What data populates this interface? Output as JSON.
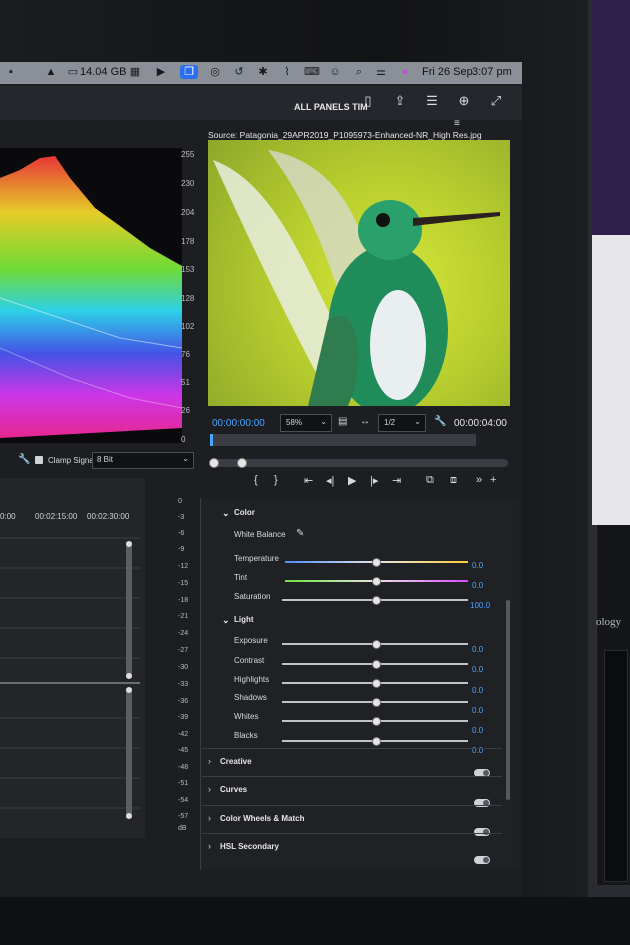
{
  "menubar": {
    "storage": "14.04 GB",
    "date": "Fri 26 Sep",
    "time": "3:07 pm"
  },
  "toolbar": {
    "workspace_label": "ALL PANELS TIM"
  },
  "scope": {
    "scale": [
      "255",
      "230",
      "204",
      "178",
      "153",
      "128",
      "102",
      "76",
      "51",
      "26",
      "0"
    ],
    "clamp_label": "Clamp Signal",
    "bit_depth": "8 Bit"
  },
  "timeline": {
    "ruler": [
      "0:00",
      "00:02:15:00",
      "00:02:30:00"
    ]
  },
  "meter": {
    "scale": [
      "0",
      "-3",
      "-6",
      "-9",
      "-12",
      "-15",
      "-18",
      "-21",
      "-24",
      "-27",
      "-30",
      "-33",
      "-36",
      "-39",
      "-42",
      "-45",
      "-48",
      "-51",
      "-54",
      "-57",
      "dB"
    ]
  },
  "program": {
    "source_label": "Source: Patagonia_29APR2019_P1095973-Enhanced-NR_High Res.jpg",
    "timecode_in": "00:00:00:00",
    "zoom": "58%",
    "resolution": "1/2",
    "timecode_out": "00:00:04:00"
  },
  "lumetri": {
    "color_section": "Color",
    "white_balance": "White Balance",
    "temperature": {
      "label": "Temperature",
      "value": "0.0"
    },
    "tint": {
      "label": "Tint",
      "value": "0.0"
    },
    "saturation": {
      "label": "Saturation",
      "value": "100.0"
    },
    "light_section": "Light",
    "exposure": {
      "label": "Exposure",
      "value": "0.0"
    },
    "contrast": {
      "label": "Contrast",
      "value": "0.0"
    },
    "highlights": {
      "label": "Highlights",
      "value": "0.0"
    },
    "shadows": {
      "label": "Shadows",
      "value": "0.0"
    },
    "whites": {
      "label": "Whites",
      "value": "0.0"
    },
    "blacks": {
      "label": "Blacks",
      "value": "0.0"
    },
    "sections": [
      "Creative",
      "Curves",
      "Color Wheels & Match",
      "HSL Secondary"
    ]
  },
  "background": {
    "device_brand": "ology"
  },
  "colors": {
    "accent": "#4aa3ff",
    "panel": "#1f2125"
  }
}
